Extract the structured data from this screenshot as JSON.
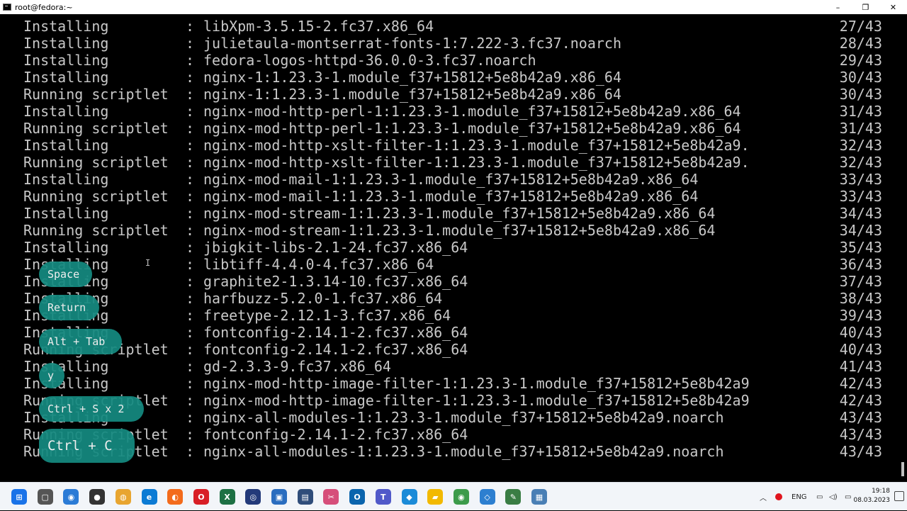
{
  "window": {
    "title": "root@fedora:~",
    "minimize": "–",
    "maximize": "❐",
    "close": "✕"
  },
  "terminal": {
    "lines": [
      {
        "action": "Installing",
        "pkg": "libXpm-3.5.15-2.fc37.x86_64",
        "count": "27/43"
      },
      {
        "action": "Installing",
        "pkg": "julietaula-montserrat-fonts-1:7.222-3.fc37.noarch",
        "count": "28/43"
      },
      {
        "action": "Installing",
        "pkg": "fedora-logos-httpd-36.0.0-3.fc37.noarch",
        "count": "29/43"
      },
      {
        "action": "Installing",
        "pkg": "nginx-1:1.23.3-1.module_f37+15812+5e8b42a9.x86_64",
        "count": "30/43"
      },
      {
        "action": "Running scriptlet",
        "pkg": "nginx-1:1.23.3-1.module_f37+15812+5e8b42a9.x86_64",
        "count": "30/43"
      },
      {
        "action": "Installing",
        "pkg": "nginx-mod-http-perl-1:1.23.3-1.module_f37+15812+5e8b42a9.x86_64",
        "count": "31/43"
      },
      {
        "action": "Running scriptlet",
        "pkg": "nginx-mod-http-perl-1:1.23.3-1.module_f37+15812+5e8b42a9.x86_64",
        "count": "31/43"
      },
      {
        "action": "Installing",
        "pkg": "nginx-mod-http-xslt-filter-1:1.23.3-1.module_f37+15812+5e8b42a9.",
        "count": "32/43"
      },
      {
        "action": "Running scriptlet",
        "pkg": "nginx-mod-http-xslt-filter-1:1.23.3-1.module_f37+15812+5e8b42a9.",
        "count": "32/43"
      },
      {
        "action": "Installing",
        "pkg": "nginx-mod-mail-1:1.23.3-1.module_f37+15812+5e8b42a9.x86_64",
        "count": "33/43"
      },
      {
        "action": "Running scriptlet",
        "pkg": "nginx-mod-mail-1:1.23.3-1.module_f37+15812+5e8b42a9.x86_64",
        "count": "33/43"
      },
      {
        "action": "Installing",
        "pkg": "nginx-mod-stream-1:1.23.3-1.module_f37+15812+5e8b42a9.x86_64",
        "count": "34/43"
      },
      {
        "action": "Running scriptlet",
        "pkg": "nginx-mod-stream-1:1.23.3-1.module_f37+15812+5e8b42a9.x86_64",
        "count": "34/43"
      },
      {
        "action": "Installing",
        "pkg": "jbigkit-libs-2.1-24.fc37.x86_64",
        "count": "35/43"
      },
      {
        "action": "Installing",
        "pkg": "libtiff-4.4.0-4.fc37.x86_64",
        "count": "36/43"
      },
      {
        "action": "Installing",
        "pkg": "graphite2-1.3.14-10.fc37.x86_64",
        "count": "37/43"
      },
      {
        "action": "Installing",
        "pkg": "harfbuzz-5.2.0-1.fc37.x86_64",
        "count": "38/43"
      },
      {
        "action": "Installing",
        "pkg": "freetype-2.12.1-3.fc37.x86_64",
        "count": "39/43"
      },
      {
        "action": "Installing",
        "pkg": "fontconfig-2.14.1-2.fc37.x86_64",
        "count": "40/43"
      },
      {
        "action": "Running scriptlet",
        "pkg": "fontconfig-2.14.1-2.fc37.x86_64",
        "count": "40/43"
      },
      {
        "action": "Installing",
        "pkg": "gd-2.3.3-9.fc37.x86_64",
        "count": "41/43"
      },
      {
        "action": "Installing",
        "pkg": "nginx-mod-http-image-filter-1:1.23.3-1.module_f37+15812+5e8b42a9",
        "count": "42/43"
      },
      {
        "action": "Running scriptlet",
        "pkg": "nginx-mod-http-image-filter-1:1.23.3-1.module_f37+15812+5e8b42a9",
        "count": "42/43"
      },
      {
        "action": "Installing",
        "pkg": "nginx-all-modules-1:1.23.3-1.module_f37+15812+5e8b42a9.noarch",
        "count": "43/43"
      },
      {
        "action": "Running scriptlet",
        "pkg": "fontconfig-2.14.1-2.fc37.x86_64",
        "count": "43/43"
      },
      {
        "action": "Running scriptlet",
        "pkg": "nginx-all-modules-1:1.23.3-1.module_f37+15812+5e8b42a9.noarch",
        "count": "43/43"
      }
    ],
    "colon": ":"
  },
  "keycaps": [
    "Space",
    "Return",
    "Alt + Tab",
    "y",
    "Ctrl + S x 2",
    "Ctrl + C"
  ],
  "taskbar": {
    "icons": [
      "windows-start-icon",
      "task-view-icon",
      "browser-globe-icon",
      "obs-record-icon",
      "chrome-canary-icon",
      "edge-icon",
      "firefox-icon",
      "opera-icon",
      "excel-icon",
      "circle-app-icon",
      "photos-icon",
      "terminal-icon",
      "snipping-icon",
      "outlook-icon",
      "teams-icon",
      "vscode-icon",
      "file-explorer-icon",
      "chrome-icon",
      "sandbox-icon",
      "notepad-icon",
      "remote-desktop-icon"
    ],
    "language": "ENG",
    "time": "19:18",
    "date": "08.03.2023"
  }
}
